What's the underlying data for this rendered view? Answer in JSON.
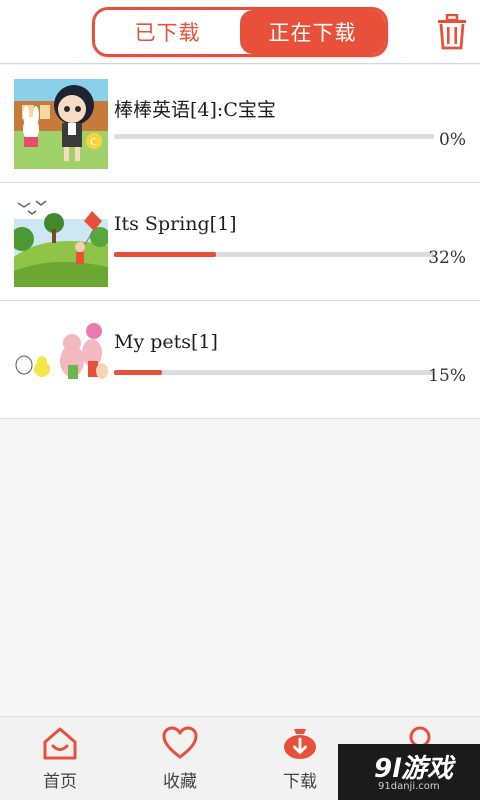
{
  "header": {
    "tabs": [
      {
        "label": "已下载",
        "active": false
      },
      {
        "label": "正在下载",
        "active": true
      }
    ],
    "delete_icon": "trash-icon",
    "accent": "#e8503a"
  },
  "downloads": [
    {
      "title": "棒棒英语[4]:C宝宝",
      "progress_text": "0%",
      "progress": 0.0,
      "thumbnail": "cartoon-girl-thumbnail"
    },
    {
      "title": "Its Spring[1]",
      "progress_text": "32%",
      "progress": 0.32,
      "thumbnail": "spring-kite-thumbnail"
    },
    {
      "title": "My pets[1]",
      "progress_text": "15%",
      "progress": 0.15,
      "thumbnail": "pets-cartoon-thumbnail"
    }
  ],
  "tabbar": {
    "items": [
      {
        "label": "首页",
        "icon": "home-icon"
      },
      {
        "label": "收藏",
        "icon": "heart-icon"
      },
      {
        "label": "下载",
        "icon": "download-icon"
      },
      {
        "label": "",
        "icon": "profile-icon"
      }
    ]
  },
  "watermark": {
    "logo": "9l游戏",
    "url": "91danji.com"
  }
}
